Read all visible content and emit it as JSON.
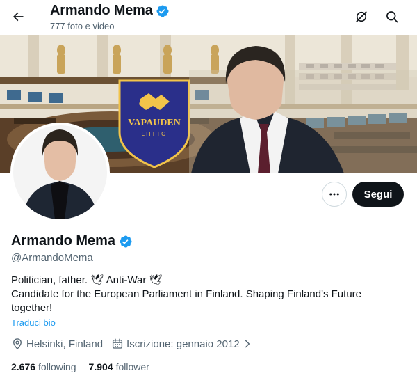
{
  "header": {
    "title": "Armando Mema",
    "subtitle": "777 foto e video"
  },
  "banner": {
    "badge_text": "VAPAUDEN",
    "badge_subtext": "LIITTO"
  },
  "actions": {
    "follow_label": "Segui"
  },
  "profile": {
    "name": "Armando Mema",
    "handle": "@ArmandoMema",
    "bio_line1": "Politician, father. 🕊 Anti-War 🕊",
    "bio_line2": "Candidate for the European Parliament in Finland. Shaping Finland's Future",
    "bio_line3": "together!",
    "translate_label": "Traduci bio",
    "location": "Helsinki, Finland",
    "joined": "Iscrizione: gennaio 2012",
    "following_count": "2.676",
    "following_label": "following",
    "followers_count": "7.904",
    "followers_label": "follower"
  },
  "colors": {
    "accent": "#1d9bf0",
    "verified": "#1d9bf0",
    "text_primary": "#0f1419",
    "text_secondary": "#536471",
    "follow_button": "#0f1419",
    "badge_blue": "#2a2f8a",
    "badge_gold": "#f2c44a"
  },
  "icons": {
    "back": "arrow-left-icon",
    "verified": "verified-badge-icon",
    "grok": "grok-icon",
    "search": "search-icon",
    "more": "more-dots-icon",
    "location": "location-pin-icon",
    "calendar": "calendar-icon",
    "chevron": "chevron-right-icon"
  }
}
